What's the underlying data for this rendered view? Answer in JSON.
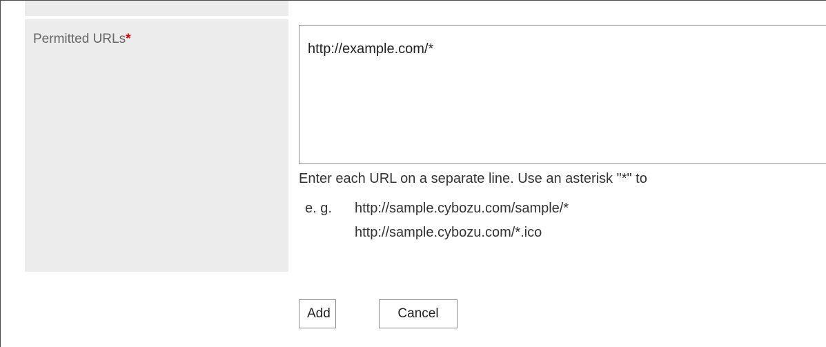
{
  "form": {
    "field_label": "Permitted URLs",
    "required_mark": "*",
    "textarea_value": "http://example.com/*",
    "hint": "Enter each URL on a separate line. Use an asterisk \"*\" to",
    "example_prefix": "e. g.",
    "examples": [
      "http://sample.cybozu.com/sample/*",
      "http://sample.cybozu.com/*.ico"
    ]
  },
  "buttons": {
    "add_label": "Add",
    "cancel_label": "Cancel"
  },
  "colors": {
    "label_background": "#ececec",
    "required_mark": "#e60000",
    "border": "#8a8a8a"
  }
}
